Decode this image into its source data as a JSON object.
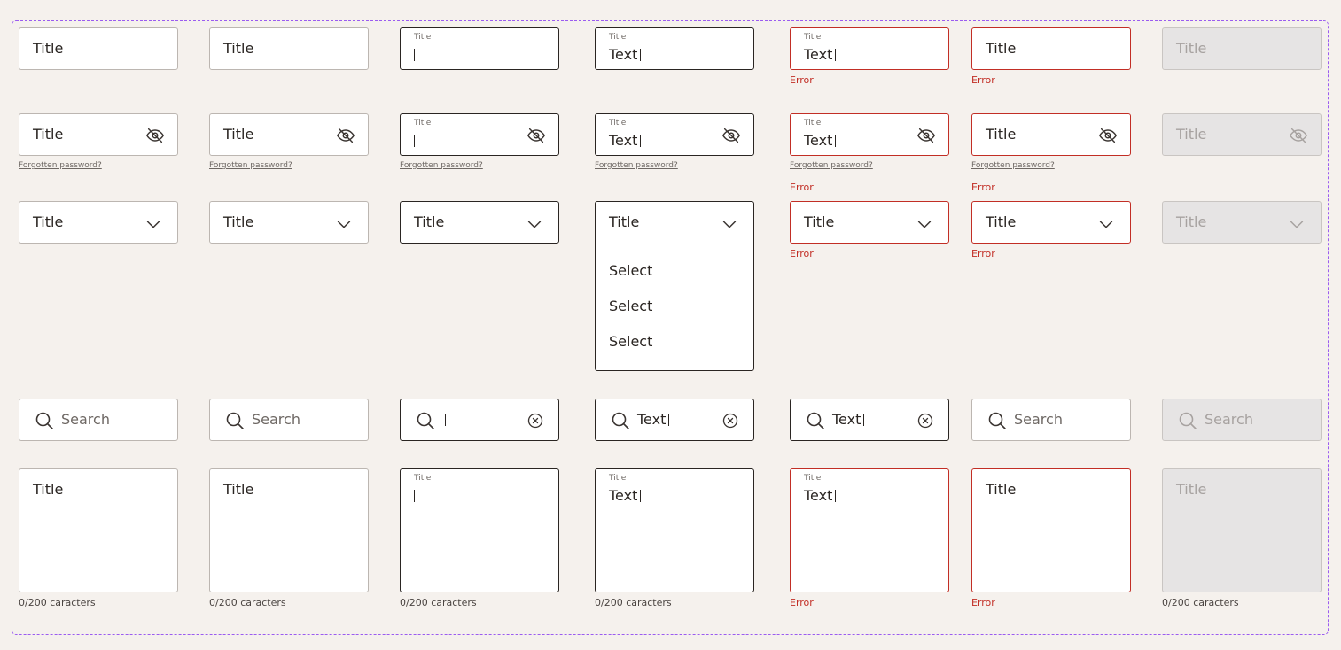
{
  "colors": {
    "background": "#f5f1ed",
    "field_background": "#ffffff",
    "default_border": "#bcb6b1",
    "active_border": "#2a2522",
    "error": "#c22e25",
    "disabled_background": "#e6e4e4",
    "frame_border": "#9b5cf0"
  },
  "icons": {
    "eye": "eye-off-icon",
    "chevron": "chevron-down-icon",
    "search": "search-icon",
    "clear": "clear-circle-icon"
  },
  "text_fields": {
    "label": "Title",
    "value": "Text",
    "error": "Error"
  },
  "password_fields": {
    "label": "Title",
    "value": "Text",
    "link": "Forgotten password?",
    "error": "Error"
  },
  "select_fields": {
    "label": "Title",
    "error": "Error",
    "options": [
      "Select",
      "Select",
      "Select"
    ]
  },
  "search_fields": {
    "placeholder": "Search",
    "value": "Text"
  },
  "textareas": {
    "label": "Title",
    "value": "Text",
    "counter": "0/200 caracters",
    "error": "Error"
  }
}
